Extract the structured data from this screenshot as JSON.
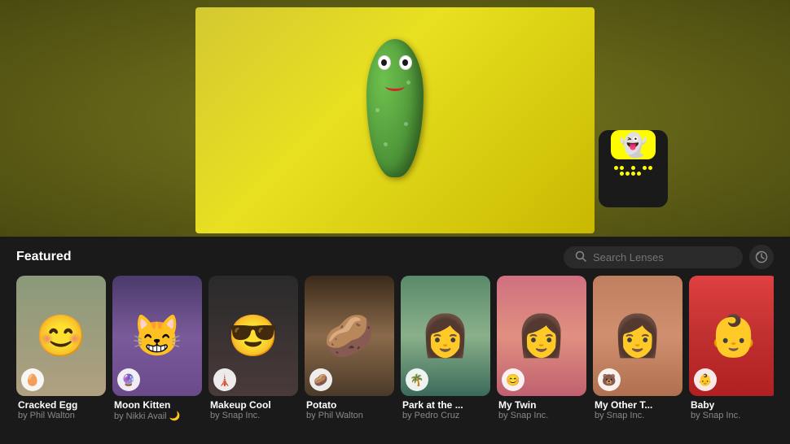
{
  "hero": {
    "background_color": "#6b6b1a"
  },
  "featured": {
    "title": "Featured",
    "search_placeholder": "Search Lenses"
  },
  "lenses": [
    {
      "id": 1,
      "name": "Cracked Egg",
      "author": "by Phil Walton",
      "thumb_class": "thumb-1",
      "icon": "🥚",
      "icon_bg": "#f5d060"
    },
    {
      "id": 2,
      "name": "Moon Kitten",
      "author": "by Nikki Avail 🌙",
      "thumb_class": "thumb-2",
      "icon": "🔮",
      "icon_bg": "#9a70cc"
    },
    {
      "id": 3,
      "name": "Makeup Cool",
      "author": "by Snap Inc.",
      "thumb_class": "thumb-3",
      "icon": "🗼",
      "icon_bg": "#4a9af0"
    },
    {
      "id": 4,
      "name": "Potato",
      "author": "by Phil Walton",
      "thumb_class": "thumb-4",
      "icon": "🥔",
      "icon_bg": "#b8924a"
    },
    {
      "id": 5,
      "name": "Park at the ...",
      "author": "by Pedro Cruz",
      "thumb_class": "thumb-5",
      "icon": "🌴",
      "icon_bg": "#4ab870"
    },
    {
      "id": 6,
      "name": "My Twin",
      "author": "by Snap Inc.",
      "thumb_class": "thumb-6",
      "icon": "😊",
      "icon_bg": "#f0a0b0"
    },
    {
      "id": 7,
      "name": "My Other T...",
      "author": "by Snap Inc.",
      "thumb_class": "thumb-7",
      "icon": "🐻",
      "icon_bg": "#d0a080"
    },
    {
      "id": 8,
      "name": "Baby",
      "author": "by Snap Inc.",
      "thumb_class": "thumb-8",
      "icon": "👶",
      "icon_bg": "#f08080"
    }
  ]
}
